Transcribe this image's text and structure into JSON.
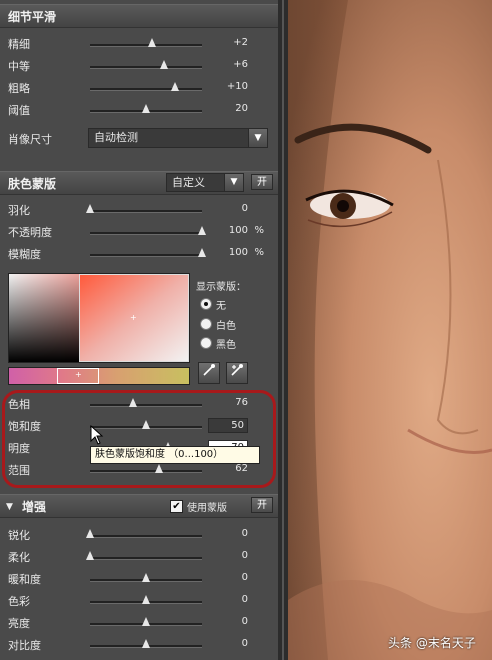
{
  "sections": {
    "detail": {
      "title": "细节平滑",
      "sliders": [
        {
          "label": "精细",
          "value": "+2",
          "level": 0.55
        },
        {
          "label": "中等",
          "value": "+6",
          "level": 0.66
        },
        {
          "label": "粗略",
          "value": "+10",
          "level": 0.76
        },
        {
          "label": "阈值",
          "value": "20",
          "level": 0.5
        }
      ],
      "portrait_size_label": "肖像尺寸",
      "portrait_size_value": "自动检测"
    },
    "skin_mask": {
      "title": "肤色蒙版",
      "preset_value": "自定义",
      "toggle_label": "开",
      "sliders": [
        {
          "label": "羽化",
          "value": "0",
          "unit": "",
          "level": 0.0
        },
        {
          "label": "不透明度",
          "value": "100",
          "unit": "%",
          "level": 1.0
        },
        {
          "label": "模糊度",
          "value": "100",
          "unit": "%",
          "level": 1.0
        }
      ],
      "display_mask_label": "显示蒙版：",
      "display_options": [
        {
          "label": "无",
          "selected": true
        },
        {
          "label": "白色",
          "selected": false
        },
        {
          "label": "黑色",
          "selected": false
        }
      ],
      "hue_slider": {
        "label": "色相",
        "value": "76",
        "level": 0.38
      },
      "saturation_slider": {
        "label": "饱和度",
        "value": "50",
        "level": 0.5
      },
      "brightness_slider": {
        "label": "明度",
        "value": "70",
        "level": 0.7
      },
      "range_slider": {
        "label": "范围",
        "value": "62",
        "level": 0.62
      },
      "tooltip": "肤色蒙版饱和度 （0...100）"
    },
    "enhance": {
      "title": "增强",
      "use_mask_label": "使用蒙版",
      "use_mask_checked": true,
      "toggle_label": "开",
      "sliders": [
        {
          "label": "锐化",
          "value": "0",
          "level": 0.0
        },
        {
          "label": "柔化",
          "value": "0",
          "level": 0.0
        },
        {
          "label": "暖和度",
          "value": "0",
          "level": 0.5
        },
        {
          "label": "色彩",
          "value": "0",
          "level": 0.5
        },
        {
          "label": "亮度",
          "value": "0",
          "level": 0.5
        },
        {
          "label": "对比度",
          "value": "0",
          "level": 0.5
        }
      ]
    }
  },
  "icons": {
    "checkmark": "✔",
    "dropdown": "▼",
    "collapse": "▼",
    "eyedropper": "eyedropper-icon",
    "eyedropper_plus": "eyedropper-plus-icon"
  },
  "watermark": "头条 @末名天子",
  "colors": {
    "panel_bg": "#4a4a4a",
    "highlight_ring": "#a8191b",
    "tooltip_bg": "#fffbe6"
  }
}
